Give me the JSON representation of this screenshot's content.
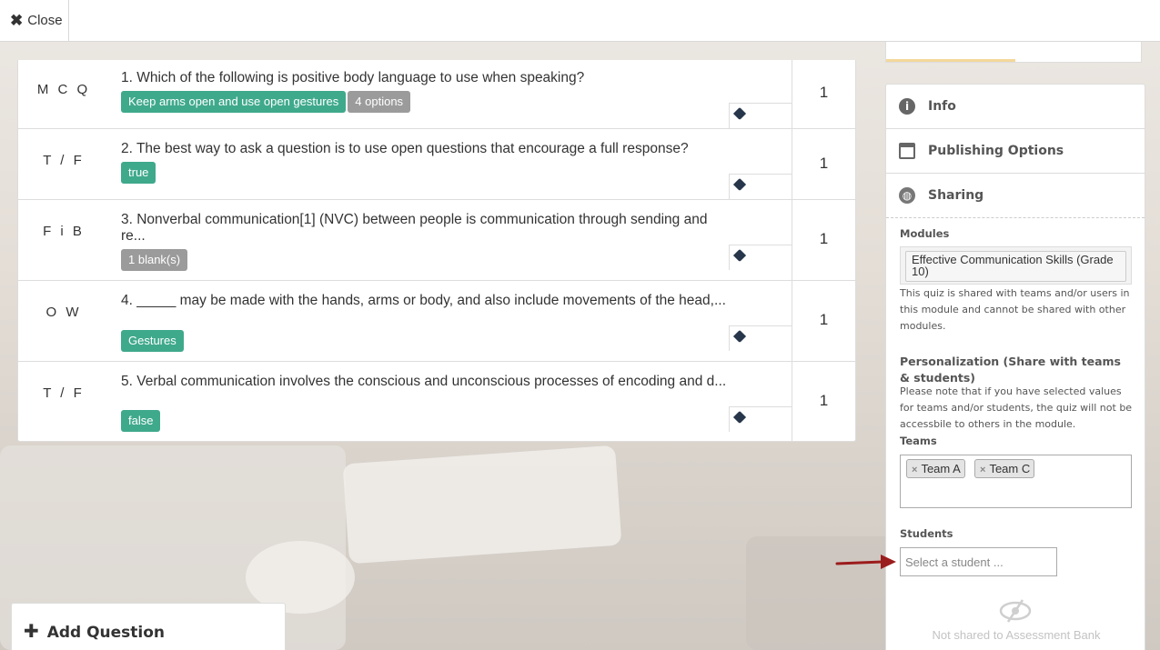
{
  "topbar": {
    "close_label": "Close"
  },
  "questions": [
    {
      "type": "M C Q",
      "text": "1. Which of the following is positive body language to use when speaking?",
      "tags": [
        {
          "label": "Keep arms open and use open gestures",
          "color": "green"
        },
        {
          "label": "4 options",
          "color": "gray"
        }
      ],
      "points": "1"
    },
    {
      "type": "T / F",
      "text": "2. The best way to ask a question is to use open questions that encourage a full response?",
      "tags": [
        {
          "label": "true",
          "color": "green"
        }
      ],
      "points": "1"
    },
    {
      "type": "F i B",
      "text": "3. Nonverbal communication[1] (NVC) between people is communication through sending and re...",
      "tags": [
        {
          "label": "1 blank(s)",
          "color": "gray"
        }
      ],
      "points": "1"
    },
    {
      "type": "O W",
      "text": "4. _____ may be made with the hands, arms or body, and also include movements of the head,...",
      "tags": [
        {
          "label": "Gestures",
          "color": "green"
        }
      ],
      "points": "1"
    },
    {
      "type": "T / F",
      "text": "5. Verbal communication involves the conscious and unconscious processes of encoding and d...",
      "tags": [
        {
          "label": "false",
          "color": "green"
        }
      ],
      "points": "1"
    }
  ],
  "add_question_label": "Add Question",
  "panel": {
    "info_label": "Info",
    "publishing_label": "Publishing Options",
    "sharing_label": "Sharing",
    "modules_label": "Modules",
    "module_chip": "Effective Communication Skills (Grade 10)",
    "modules_help": "This quiz is shared with teams and/or users in this module and cannot be shared with other modules.",
    "personalization_title": "Personalization (Share with teams & students)",
    "personalization_help": "Please note that if you have selected values for teams and/or students, the quiz will not be accessbile to others in the module.",
    "teams_label": "Teams",
    "teams": [
      "Team A",
      "Team C"
    ],
    "students_label": "Students",
    "students_placeholder": "Select a student ...",
    "not_shared_label": "Not shared to Assessment Bank"
  },
  "colors": {
    "tag_green": "#3fa98c",
    "tag_gray": "#9b9b9b",
    "arrow": "#9b1c1c"
  }
}
